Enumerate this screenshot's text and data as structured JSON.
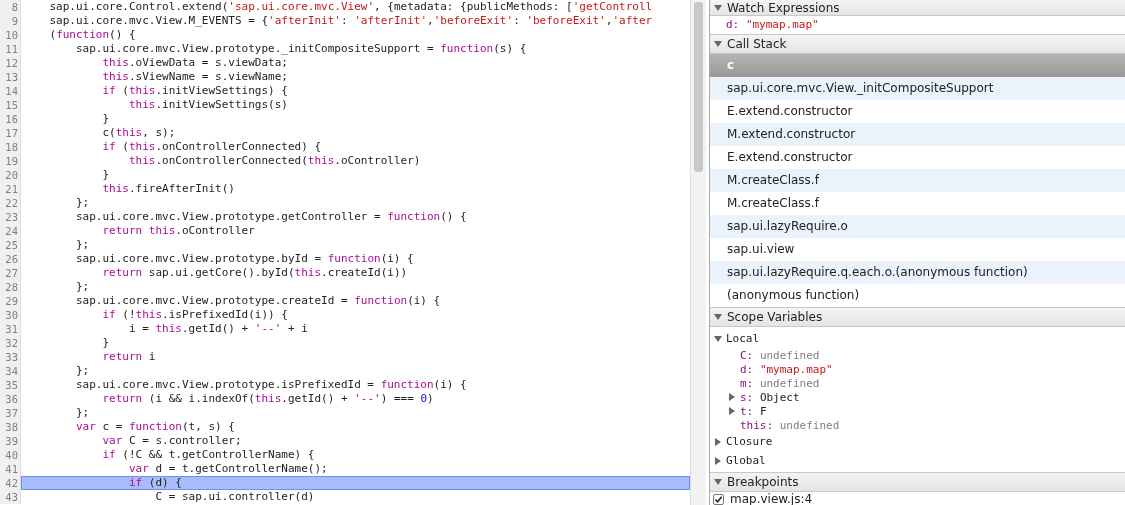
{
  "editor": {
    "lines": [
      {
        "number": "8",
        "selected": false,
        "tokens": [
          {
            "kind": "plain",
            "text": "    sap.ui.core.Control.extend("
          },
          {
            "kind": "string",
            "text": "'sap.ui.core.mvc.View'"
          },
          {
            "kind": "plain",
            "text": ", {metadata: {publicMethods: ["
          },
          {
            "kind": "string",
            "text": "'getControll"
          }
        ]
      },
      {
        "number": "9",
        "selected": false,
        "tokens": [
          {
            "kind": "plain",
            "text": "    sap.ui.core.mvc.View.M_EVENTS = {"
          },
          {
            "kind": "string",
            "text": "'afterInit'"
          },
          {
            "kind": "plain",
            "text": ": "
          },
          {
            "kind": "string",
            "text": "'afterInit'"
          },
          {
            "kind": "plain",
            "text": ","
          },
          {
            "kind": "string",
            "text": "'beforeExit'"
          },
          {
            "kind": "plain",
            "text": ": "
          },
          {
            "kind": "string",
            "text": "'beforeExit'"
          },
          {
            "kind": "plain",
            "text": ","
          },
          {
            "kind": "string",
            "text": "'after"
          }
        ]
      },
      {
        "number": "10",
        "selected": false,
        "tokens": [
          {
            "kind": "plain",
            "text": "    ("
          },
          {
            "kind": "keyword",
            "text": "function"
          },
          {
            "kind": "plain",
            "text": "() {"
          }
        ]
      },
      {
        "number": "11",
        "selected": false,
        "tokens": [
          {
            "kind": "plain",
            "text": "        sap.ui.core.mvc.View.prototype._initCompositeSupport = "
          },
          {
            "kind": "keyword",
            "text": "function"
          },
          {
            "kind": "plain",
            "text": "(s) {"
          }
        ]
      },
      {
        "number": "12",
        "selected": false,
        "tokens": [
          {
            "kind": "keyword",
            "text": "            this"
          },
          {
            "kind": "plain",
            "text": ".oViewData = s.viewData;"
          }
        ]
      },
      {
        "number": "13",
        "selected": false,
        "tokens": [
          {
            "kind": "keyword",
            "text": "            this"
          },
          {
            "kind": "plain",
            "text": ".sViewName = s.viewName;"
          }
        ]
      },
      {
        "number": "14",
        "selected": false,
        "tokens": [
          {
            "kind": "keyword",
            "text": "            if"
          },
          {
            "kind": "plain",
            "text": " ("
          },
          {
            "kind": "keyword",
            "text": "this"
          },
          {
            "kind": "plain",
            "text": ".initViewSettings) {"
          }
        ]
      },
      {
        "number": "15",
        "selected": false,
        "tokens": [
          {
            "kind": "keyword",
            "text": "                this"
          },
          {
            "kind": "plain",
            "text": ".initViewSettings(s)"
          }
        ]
      },
      {
        "number": "16",
        "selected": false,
        "tokens": [
          {
            "kind": "plain",
            "text": "            }"
          }
        ]
      },
      {
        "number": "17",
        "selected": false,
        "tokens": [
          {
            "kind": "plain",
            "text": "            c("
          },
          {
            "kind": "keyword",
            "text": "this"
          },
          {
            "kind": "plain",
            "text": ", s);"
          }
        ]
      },
      {
        "number": "18",
        "selected": false,
        "tokens": [
          {
            "kind": "keyword",
            "text": "            if"
          },
          {
            "kind": "plain",
            "text": " ("
          },
          {
            "kind": "keyword",
            "text": "this"
          },
          {
            "kind": "plain",
            "text": ".onControllerConnected) {"
          }
        ]
      },
      {
        "number": "19",
        "selected": false,
        "tokens": [
          {
            "kind": "keyword",
            "text": "                this"
          },
          {
            "kind": "plain",
            "text": ".onControllerConnected("
          },
          {
            "kind": "keyword",
            "text": "this"
          },
          {
            "kind": "plain",
            "text": ".oController)"
          }
        ]
      },
      {
        "number": "20",
        "selected": false,
        "tokens": [
          {
            "kind": "plain",
            "text": "            }"
          }
        ]
      },
      {
        "number": "21",
        "selected": false,
        "tokens": [
          {
            "kind": "keyword",
            "text": "            this"
          },
          {
            "kind": "plain",
            "text": ".fireAfterInit()"
          }
        ]
      },
      {
        "number": "22",
        "selected": false,
        "tokens": [
          {
            "kind": "plain",
            "text": "        };"
          }
        ]
      },
      {
        "number": "23",
        "selected": false,
        "tokens": [
          {
            "kind": "plain",
            "text": "        sap.ui.core.mvc.View.prototype.getController = "
          },
          {
            "kind": "keyword",
            "text": "function"
          },
          {
            "kind": "plain",
            "text": "() {"
          }
        ]
      },
      {
        "number": "24",
        "selected": false,
        "tokens": [
          {
            "kind": "keyword",
            "text": "            return this"
          },
          {
            "kind": "plain",
            "text": ".oController"
          }
        ]
      },
      {
        "number": "25",
        "selected": false,
        "tokens": [
          {
            "kind": "plain",
            "text": "        };"
          }
        ]
      },
      {
        "number": "26",
        "selected": false,
        "tokens": [
          {
            "kind": "plain",
            "text": "        sap.ui.core.mvc.View.prototype.byId = "
          },
          {
            "kind": "keyword",
            "text": "function"
          },
          {
            "kind": "plain",
            "text": "(i) {"
          }
        ]
      },
      {
        "number": "27",
        "selected": false,
        "tokens": [
          {
            "kind": "keyword",
            "text": "            return"
          },
          {
            "kind": "plain",
            "text": " sap.ui.getCore().byId("
          },
          {
            "kind": "keyword",
            "text": "this"
          },
          {
            "kind": "plain",
            "text": ".createId(i))"
          }
        ]
      },
      {
        "number": "28",
        "selected": false,
        "tokens": [
          {
            "kind": "plain",
            "text": "        };"
          }
        ]
      },
      {
        "number": "29",
        "selected": false,
        "tokens": [
          {
            "kind": "plain",
            "text": "        sap.ui.core.mvc.View.prototype.createId = "
          },
          {
            "kind": "keyword",
            "text": "function"
          },
          {
            "kind": "plain",
            "text": "(i) {"
          }
        ]
      },
      {
        "number": "30",
        "selected": false,
        "tokens": [
          {
            "kind": "keyword",
            "text": "            if"
          },
          {
            "kind": "plain",
            "text": " (!"
          },
          {
            "kind": "keyword",
            "text": "this"
          },
          {
            "kind": "plain",
            "text": ".isPrefixedId(i)) {"
          }
        ]
      },
      {
        "number": "31",
        "selected": false,
        "tokens": [
          {
            "kind": "plain",
            "text": "                i = "
          },
          {
            "kind": "keyword",
            "text": "this"
          },
          {
            "kind": "plain",
            "text": ".getId() + "
          },
          {
            "kind": "string",
            "text": "'--'"
          },
          {
            "kind": "plain",
            "text": " + i"
          }
        ]
      },
      {
        "number": "32",
        "selected": false,
        "tokens": [
          {
            "kind": "plain",
            "text": "            }"
          }
        ]
      },
      {
        "number": "33",
        "selected": false,
        "tokens": [
          {
            "kind": "keyword",
            "text": "            return"
          },
          {
            "kind": "plain",
            "text": " i"
          }
        ]
      },
      {
        "number": "34",
        "selected": false,
        "tokens": [
          {
            "kind": "plain",
            "text": "        };"
          }
        ]
      },
      {
        "number": "35",
        "selected": false,
        "tokens": [
          {
            "kind": "plain",
            "text": "        sap.ui.core.mvc.View.prototype.isPrefixedId = "
          },
          {
            "kind": "keyword",
            "text": "function"
          },
          {
            "kind": "plain",
            "text": "(i) {"
          }
        ]
      },
      {
        "number": "36",
        "selected": false,
        "tokens": [
          {
            "kind": "keyword",
            "text": "            return"
          },
          {
            "kind": "plain",
            "text": " (i && i.indexOf("
          },
          {
            "kind": "keyword",
            "text": "this"
          },
          {
            "kind": "plain",
            "text": ".getId() + "
          },
          {
            "kind": "string",
            "text": "'--'"
          },
          {
            "kind": "plain",
            "text": ") === "
          },
          {
            "kind": "number",
            "text": "0"
          },
          {
            "kind": "plain",
            "text": ")"
          }
        ]
      },
      {
        "number": "37",
        "selected": false,
        "tokens": [
          {
            "kind": "plain",
            "text": "        };"
          }
        ]
      },
      {
        "number": "38",
        "selected": false,
        "tokens": [
          {
            "kind": "keyword",
            "text": "        var"
          },
          {
            "kind": "plain",
            "text": " c = "
          },
          {
            "kind": "keyword",
            "text": "function"
          },
          {
            "kind": "plain",
            "text": "(t, s) {"
          }
        ]
      },
      {
        "number": "39",
        "selected": false,
        "tokens": [
          {
            "kind": "keyword",
            "text": "            var"
          },
          {
            "kind": "plain",
            "text": " C = s.controller;"
          }
        ]
      },
      {
        "number": "40",
        "selected": false,
        "tokens": [
          {
            "kind": "keyword",
            "text": "            if"
          },
          {
            "kind": "plain",
            "text": " (!C && t.getControllerName) {"
          }
        ]
      },
      {
        "number": "41",
        "selected": false,
        "tokens": [
          {
            "kind": "keyword",
            "text": "                var"
          },
          {
            "kind": "plain",
            "text": " d = t.getControllerName();"
          }
        ]
      },
      {
        "number": "42",
        "selected": true,
        "tokens": [
          {
            "kind": "keyword",
            "text": "                if"
          },
          {
            "kind": "plain",
            "text": " (d) {"
          }
        ]
      },
      {
        "number": "43",
        "selected": false,
        "tokens": [
          {
            "kind": "plain",
            "text": "                    C = sap.ui.controller(d)"
          }
        ]
      }
    ]
  },
  "watch_expressions": {
    "title": "Watch Expressions",
    "expanded": true,
    "items": [
      {
        "name": "d:",
        "value": "\"mymap.map\"",
        "kind": "string"
      }
    ]
  },
  "call_stack": {
    "title": "Call Stack",
    "expanded": true,
    "frames": [
      {
        "label": "c",
        "selected": true
      },
      {
        "label": "sap.ui.core.mvc.View._initCompositeSupport",
        "selected": false
      },
      {
        "label": "E.extend.constructor",
        "selected": false
      },
      {
        "label": "M.extend.constructor",
        "selected": false
      },
      {
        "label": "E.extend.constructor",
        "selected": false
      },
      {
        "label": "M.createClass.f",
        "selected": false
      },
      {
        "label": "M.createClass.f",
        "selected": false
      },
      {
        "label": "sap.ui.lazyRequire.o",
        "selected": false
      },
      {
        "label": "sap.ui.view",
        "selected": false
      },
      {
        "label": "sap.ui.lazyRequire.q.each.o.(anonymous function)",
        "selected": false
      },
      {
        "label": "(anonymous function)",
        "selected": false
      }
    ]
  },
  "scope_variables": {
    "title": "Scope Variables",
    "expanded": true,
    "scopes": [
      {
        "label": "Local",
        "expanded": true,
        "children": [
          {
            "name": "C:",
            "value": "undefined",
            "kind": "undefined"
          },
          {
            "name": "d:",
            "value": "\"mymap.map\"",
            "kind": "string"
          },
          {
            "name": "m:",
            "value": "undefined",
            "kind": "undefined"
          },
          {
            "name": "s:",
            "value": "Object",
            "kind": "object",
            "expanded": false
          },
          {
            "name": "t:",
            "value": "F",
            "kind": "object",
            "expanded": false
          },
          {
            "name": "this:",
            "value": "undefined",
            "kind": "undefined"
          }
        ]
      },
      {
        "label": "Closure",
        "expanded": false
      },
      {
        "label": "Global",
        "expanded": false
      }
    ]
  },
  "breakpoints": {
    "title": "Breakpoints",
    "expanded": true,
    "items": [
      {
        "label": "map.view.js:4",
        "checked": true
      }
    ]
  }
}
